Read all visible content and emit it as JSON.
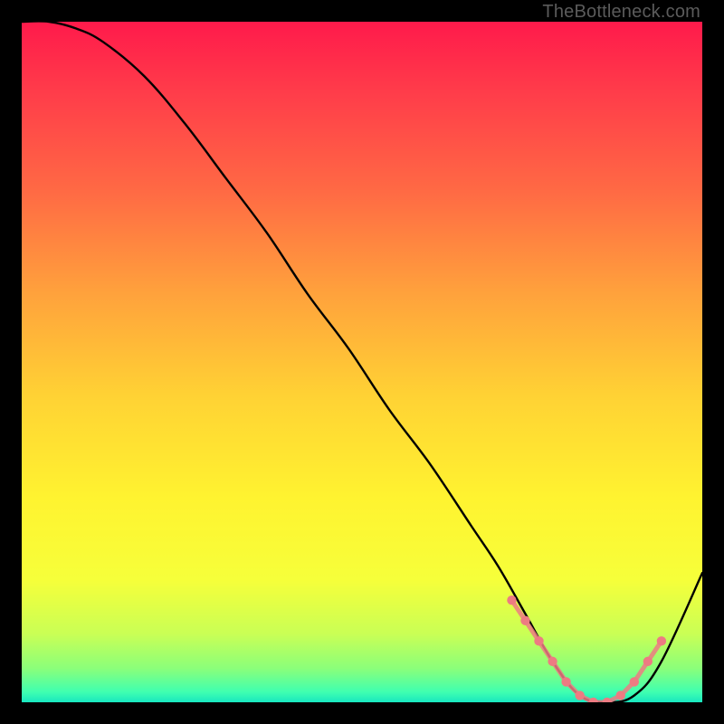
{
  "watermark": "TheBottleneck.com",
  "chart_data": {
    "type": "line",
    "title": "",
    "xlabel": "",
    "ylabel": "",
    "xlim": [
      0,
      100
    ],
    "ylim": [
      0,
      100
    ],
    "background_gradient": {
      "stops": [
        {
          "offset": 0.0,
          "color": "#ff1a4b"
        },
        {
          "offset": 0.1,
          "color": "#ff3b4a"
        },
        {
          "offset": 0.25,
          "color": "#ff6a44"
        },
        {
          "offset": 0.4,
          "color": "#ffa23c"
        },
        {
          "offset": 0.55,
          "color": "#ffd234"
        },
        {
          "offset": 0.7,
          "color": "#fff330"
        },
        {
          "offset": 0.82,
          "color": "#f6ff3a"
        },
        {
          "offset": 0.9,
          "color": "#c9ff55"
        },
        {
          "offset": 0.95,
          "color": "#8bff7a"
        },
        {
          "offset": 0.985,
          "color": "#3fffb0"
        },
        {
          "offset": 1.0,
          "color": "#18e7c0"
        }
      ]
    },
    "series": [
      {
        "name": "bottleneck-curve",
        "color": "#000000",
        "x": [
          0,
          4,
          8,
          12,
          18,
          24,
          30,
          36,
          42,
          48,
          54,
          60,
          66,
          70,
          74,
          78,
          82,
          86,
          90,
          94,
          100
        ],
        "y": [
          100,
          100,
          99,
          97,
          92,
          85,
          77,
          69,
          60,
          52,
          43,
          35,
          26,
          20,
          13,
          6,
          1,
          0,
          1,
          6,
          19
        ]
      }
    ],
    "marker_segment": {
      "name": "optimum-range",
      "color": "#ed7b82",
      "x": [
        72,
        74,
        76,
        78,
        80,
        82,
        84,
        86,
        88,
        90,
        92,
        94
      ],
      "y": [
        15,
        12,
        9,
        6,
        3,
        1,
        0,
        0,
        1,
        3,
        6,
        9
      ]
    }
  }
}
